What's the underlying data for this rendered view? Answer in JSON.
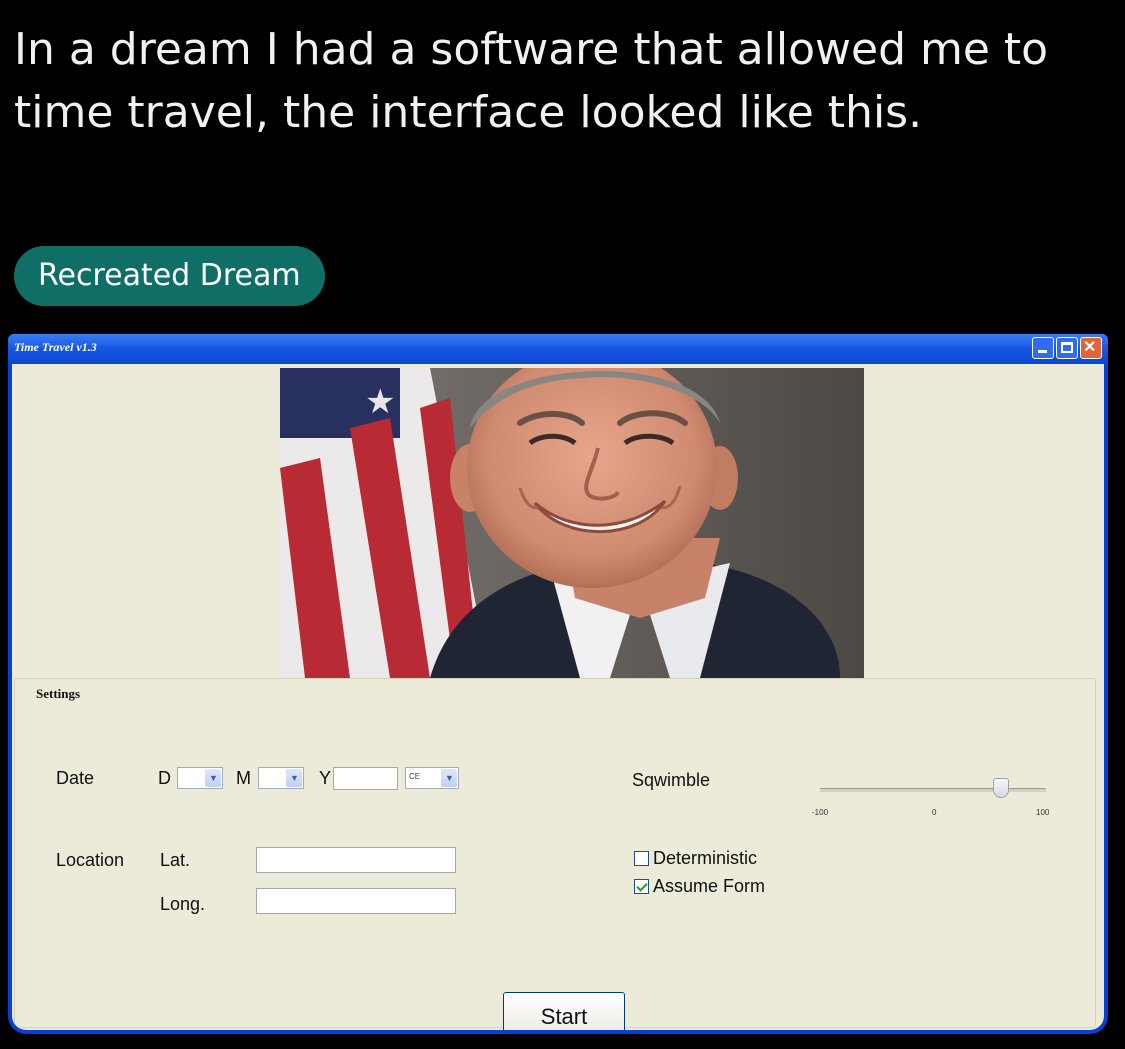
{
  "post": {
    "text": "In a dream I had a software that allowed me to time travel, the interface looked like this.",
    "flair": "Recreated Dream"
  },
  "window": {
    "title": "Time Travel v1.3",
    "controls": [
      "minimize-icon",
      "maximize-icon",
      "close-icon"
    ]
  },
  "settings": {
    "group_title": "Settings",
    "date": {
      "label": "Date",
      "day_label": "D",
      "month_label": "M",
      "year_label": "Y",
      "day_value": "",
      "month_value": "",
      "year_value": "",
      "era_value": "CE"
    },
    "location": {
      "label": "Location",
      "lat_label": "Lat.",
      "long_label": "Long.",
      "lat_value": "",
      "long_value": ""
    },
    "sqwimble": {
      "label": "Sqwimble",
      "min": -100,
      "max": 100,
      "value": 60,
      "min_label": "-100",
      "mid_label": "0",
      "max_label": "100"
    },
    "deterministic": {
      "label": "Deterministic",
      "checked": false
    },
    "assume_form": {
      "label": "Assume Form",
      "checked": true
    }
  },
  "start_button": {
    "label": "Start"
  },
  "colors": {
    "titlebar": "#1656e0",
    "client_bg": "#ecead9",
    "flair_bg": "#0f6e66"
  }
}
